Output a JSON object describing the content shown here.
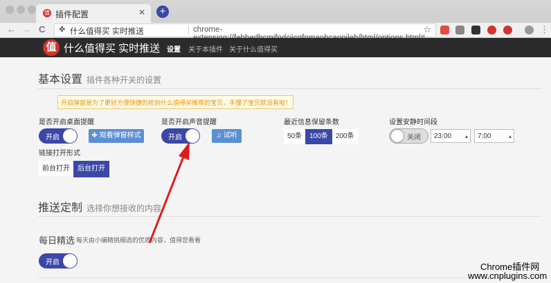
{
  "browser": {
    "tab_title": "插件配置",
    "tab_favicon": "值",
    "tab_close": "✕",
    "new_tab": "+",
    "back": "←",
    "forward": "→",
    "reload": "C",
    "omnibox_label": "什么值得买 实时推送",
    "url": "chrome-extension://febhedbcmjfndciicgfnmaohcaopileb/html/options.html#",
    "star": "☆",
    "menu": "⋮"
  },
  "header": {
    "logo": "值",
    "brand": "什么值得买 实时推送",
    "nav": [
      "设置",
      "关于本插件",
      "关于什么值得买"
    ]
  },
  "basic": {
    "title": "基本设置",
    "subtitle": "插件各种开关的设置",
    "notice": "开启弹窗是为了更好方便快捷的抢到什么值得买推荐的宝贝，手慢了宝贝就没有啦！",
    "desktop_label": "是否开启桌面提醒",
    "desktop_toggle": "开启",
    "view_popup": "✚ 观看弹窗样式",
    "sound_label": "是否开启声音提醒",
    "sound_toggle": "开启",
    "test_sound": "♫ 试听",
    "keep_label": "最近信息保留条数",
    "keep_options": [
      "50条",
      "100条",
      "200条"
    ],
    "quiet_label": "设置安静时间段",
    "quiet_toggle": "关闭",
    "quiet_start": "23:00",
    "quiet_end": "7:00",
    "link_label": "链接打开形式",
    "link_options": [
      "前台打开",
      "后台打开"
    ]
  },
  "push": {
    "title": "推送定制",
    "subtitle": "选择你想接收的内容",
    "daily_title": "每日精选",
    "daily_desc": "每天由小编精挑细选的优质内容，值得您看看",
    "daily_toggle": "开启"
  },
  "watermark": {
    "line1": "Chrome插件网",
    "line2": "www.cnplugins.com"
  },
  "colors": {
    "accent": "#3b48a8",
    "button_blue": "#5b8fd4",
    "notice_text": "#e8900c",
    "arrow": "#e01b1b"
  }
}
